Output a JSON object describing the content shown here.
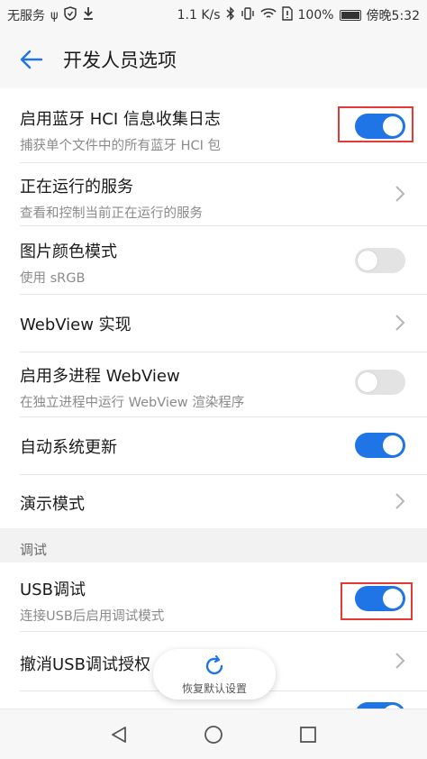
{
  "status_bar": {
    "carrier": "无服务",
    "network_speed": "1.1 K/s",
    "battery": "100%",
    "time": "傍晚5:32"
  },
  "app_bar": {
    "title": "开发人员选项"
  },
  "colors": {
    "accent": "#1f74e6",
    "highlight": "#e53935"
  },
  "items": [
    {
      "title": "启用蓝牙 HCI 信息收集日志",
      "subtitle": "捕获单个文件中的所有蓝牙 HCI 包",
      "control": "toggle",
      "on": true
    },
    {
      "title": "正在运行的服务",
      "subtitle": "查看和控制当前正在运行的服务",
      "control": "chevron"
    },
    {
      "title": "图片颜色模式",
      "subtitle": "使用 sRGB",
      "control": "toggle",
      "on": false
    },
    {
      "title": "WebView 实现",
      "control": "chevron"
    },
    {
      "title": "启用多进程 WebView",
      "subtitle": "在独立进程中运行 WebView 渲染程序",
      "control": "toggle",
      "on": false
    },
    {
      "title": "自动系统更新",
      "control": "toggle",
      "on": true
    },
    {
      "title": "演示模式",
      "control": "chevron"
    }
  ],
  "debug_section": {
    "label": "调试",
    "items": [
      {
        "title": "USB调试",
        "subtitle": "连接USB后启用调试模式",
        "control": "toggle",
        "on": true
      },
      {
        "title": "撤消USB调试授权",
        "control": "chevron"
      }
    ]
  },
  "restore_button": {
    "label": "恢复默认设置"
  },
  "nav_bar": {
    "back": "back-icon",
    "home": "home-icon",
    "recents": "recents-icon"
  }
}
